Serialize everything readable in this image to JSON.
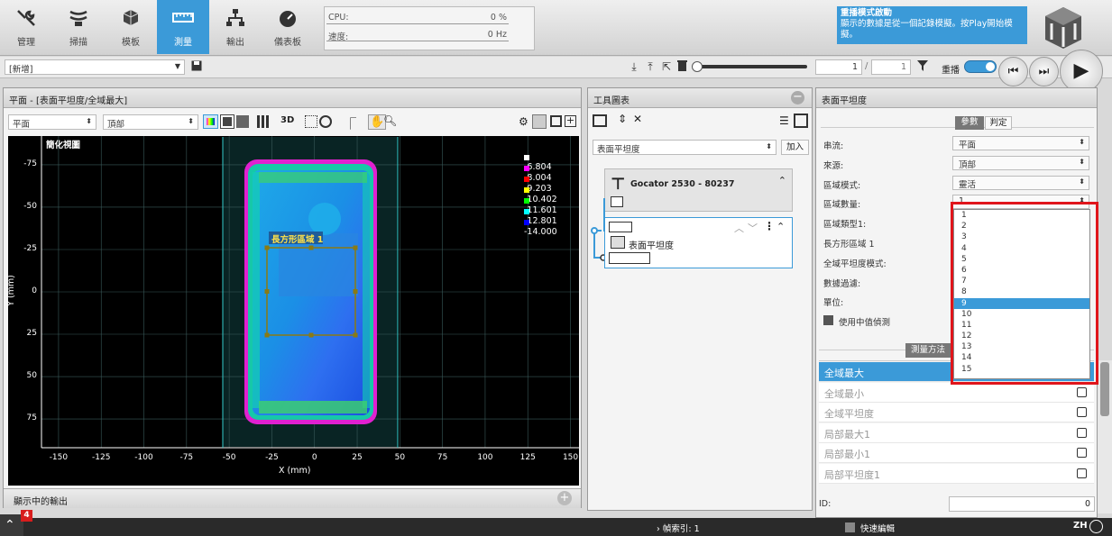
{
  "nav": [
    {
      "label": "管理",
      "icon": "tools-icon"
    },
    {
      "label": "掃描",
      "icon": "scan-icon"
    },
    {
      "label": "模板",
      "icon": "cubes-icon"
    },
    {
      "label": "測量",
      "icon": "ruler-icon",
      "active": true
    },
    {
      "label": "輸出",
      "icon": "network-icon"
    },
    {
      "label": "儀表板",
      "icon": "gauge-icon"
    }
  ],
  "metrics": {
    "cpu_label": "CPU:",
    "cpu_value": "0 %",
    "speed_label": "速度:",
    "speed_value": "0 Hz"
  },
  "replay_notice": {
    "title": "重播模式啟動",
    "body": "顯示的數據是從一個記錄模擬。按Play開始模擬。"
  },
  "toolbar": {
    "job_name": "[新增]",
    "frame_current": "1",
    "frame_separator": "/",
    "frame_total": "1",
    "replay_label": "重播"
  },
  "view_panel": {
    "title": "平面 - [表面平坦度/全域最大]",
    "view_select": "平面",
    "source_select": "頂部",
    "btn_3d": "3D",
    "simplified_label": "簡化視圖",
    "footer": "顯示中的輸出",
    "region_label": "長方形區域 1"
  },
  "chart_data": {
    "type": "heatmap",
    "xlabel": "X (mm)",
    "ylabel": "Y (mm)",
    "xlim": [
      -160,
      155
    ],
    "ylim": [
      92,
      -92
    ],
    "x_ticks": [
      -150,
      -125,
      -100,
      -75,
      -50,
      -25,
      0,
      25,
      50,
      75,
      100,
      125,
      150
    ],
    "y_ticks": [
      -75,
      -50,
      -25,
      0,
      25,
      50,
      75
    ],
    "legend": [
      {
        "label": "-6.804",
        "color": "#ffffff"
      },
      {
        "label": "-8.004",
        "color": "#ff00ff"
      },
      {
        "label": "-9.203",
        "color": "#ff0000"
      },
      {
        "label": "-10.402",
        "color": "#ffff00"
      },
      {
        "label": "-11.601",
        "color": "#00ff00"
      },
      {
        "label": "-12.801",
        "color": "#00ffff"
      },
      {
        "label": "-14.000",
        "color": "#0000ff"
      }
    ],
    "colors": {
      "region_box": "#8a7a14",
      "region_label_bg": "#1e5c9a"
    }
  },
  "tools_panel": {
    "title": "工具圖表",
    "tool_select": "表面平坦度",
    "add_label": "加入",
    "sensor_label": "Gocator 2530 - 80237",
    "tool_label": "表面平坦度"
  },
  "props_panel": {
    "title": "表面平坦度",
    "tab_params": "參數",
    "tab_decision": "判定",
    "rows": [
      {
        "label": "串流:",
        "value": "平面",
        "type": "select"
      },
      {
        "label": "來源:",
        "value": "頂部",
        "type": "select"
      },
      {
        "label": "區域模式:",
        "value": "靈活",
        "type": "select"
      },
      {
        "label": "區域數量:",
        "value": "1",
        "type": "select"
      },
      {
        "label": "區域類型1:",
        "value": "",
        "type": "none"
      },
      {
        "label": "長方形區域 1",
        "value": "",
        "type": "none"
      },
      {
        "label": "全域平坦度模式:",
        "value": "",
        "type": "none"
      },
      {
        "label": "數據過濾:",
        "value": "",
        "type": "none"
      },
      {
        "label": "單位:",
        "value": "",
        "type": "none"
      }
    ],
    "median_label": "使用中值偵測",
    "dropdown_options": [
      "1",
      "2",
      "3",
      "4",
      "5",
      "6",
      "7",
      "8",
      "9",
      "10",
      "11",
      "12",
      "13",
      "14",
      "15"
    ],
    "dropdown_selected": "9",
    "measure_header": "測量方法",
    "measurements": [
      {
        "label": "全域最大",
        "selected": true
      },
      {
        "label": "全域最小"
      },
      {
        "label": "全域平坦度"
      },
      {
        "label": "局部最大1"
      },
      {
        "label": "局部最小1"
      },
      {
        "label": "局部平坦度1"
      }
    ],
    "id_label": "ID:",
    "id_value": "0"
  },
  "status_bar": {
    "badge": "4",
    "frame_index": "幀索引: 1",
    "quick_edit": "快速編輯",
    "lang": "ZH"
  },
  "colors": {
    "accent": "#3b9ad8",
    "highlight_red": "#e0151b"
  }
}
